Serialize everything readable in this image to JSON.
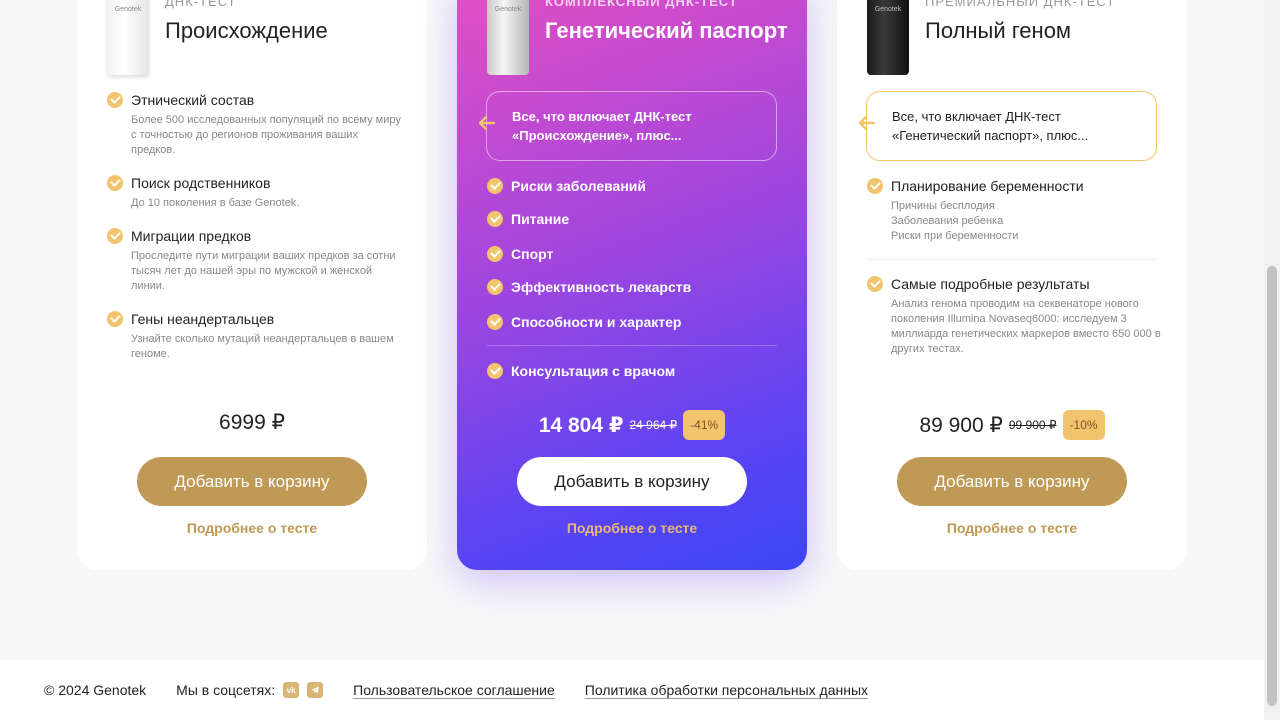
{
  "cards": [
    {
      "subtitle": "ДНК-ТЕСТ",
      "title": "Происхождение",
      "logo": "Genotek",
      "features": [
        {
          "title": "Этнический состав",
          "desc": "Более 500 исследованных популяций по всему миру с точностью до регионов проживания ваших предков."
        },
        {
          "title": "Поиск родственников",
          "desc": "До 10 поколения в базе Genotek."
        },
        {
          "title": "Миграции предков",
          "desc": "Проследите пути миграции ваших предков за сотни тысяч лет до нашей эры по мужской и женской линии."
        },
        {
          "title": "Гены неандертальцев",
          "desc": "Узнайте сколько мутаций неандертальцев в вашем геноме."
        }
      ],
      "price": "6999 ₽",
      "cart_label": "Добавить в корзину",
      "more_label": "Подробнее о тесте"
    },
    {
      "subtitle": "КОМПЛЕКСНЫЙ ДНК-ТЕСТ",
      "title": "Генетический паспорт",
      "logo": "Genotek",
      "includes": "Все, что включает ДНК-тест «Происхождение», плюс...",
      "features": [
        {
          "title": "Риски заболеваний"
        },
        {
          "title": "Питание"
        },
        {
          "title": "Спорт"
        },
        {
          "title": "Эффективность лекарств"
        },
        {
          "title": "Способности и характер"
        },
        {
          "title": "Консультация с врачом"
        }
      ],
      "price": "14 804 ₽",
      "old_price": "24 964 ₽",
      "discount": "-41%",
      "cart_label": "Добавить в корзину",
      "more_label": "Подробнее о тесте"
    },
    {
      "subtitle": "ПРЕМИАЛЬНЫЙ ДНК-ТЕСТ",
      "title": "Полный геном",
      "logo": "Genotek",
      "includes": "Все, что включает ДНК-тест «Генетический паспорт», плюс...",
      "features": [
        {
          "title": "Планирование беременности",
          "desc": "Причины бесплодия\nЗаболевания ребенка\nРиски при беременности"
        },
        {
          "title": "Самые подробные результаты",
          "desc": "Анализ генома проводим на секвенаторе нового поколения Illumina Novaseq6000: исследуем 3 миллиарда генетических маркеров вместо 650 000 в других тестах."
        }
      ],
      "price": "89 900 ₽",
      "old_price": "99 900 ₽",
      "discount": "-10%",
      "cart_label": "Добавить в корзину",
      "more_label": "Подробнее о тесте"
    }
  ],
  "footer": {
    "copyright": "© 2024 Genotek",
    "social_label": "Мы в соцсетях:",
    "social_icons": [
      "vk-icon",
      "telegram-icon"
    ],
    "vk_text": "vk",
    "agreement_link": "Пользовательское соглашение",
    "privacy_link": "Политика обработки персональных данных"
  },
  "colors": {
    "accent_gold": "#bf9a56",
    "check_yellow": "#f2c46e",
    "gradient_start": "#e44fc2",
    "gradient_end": "#3b46f4"
  }
}
